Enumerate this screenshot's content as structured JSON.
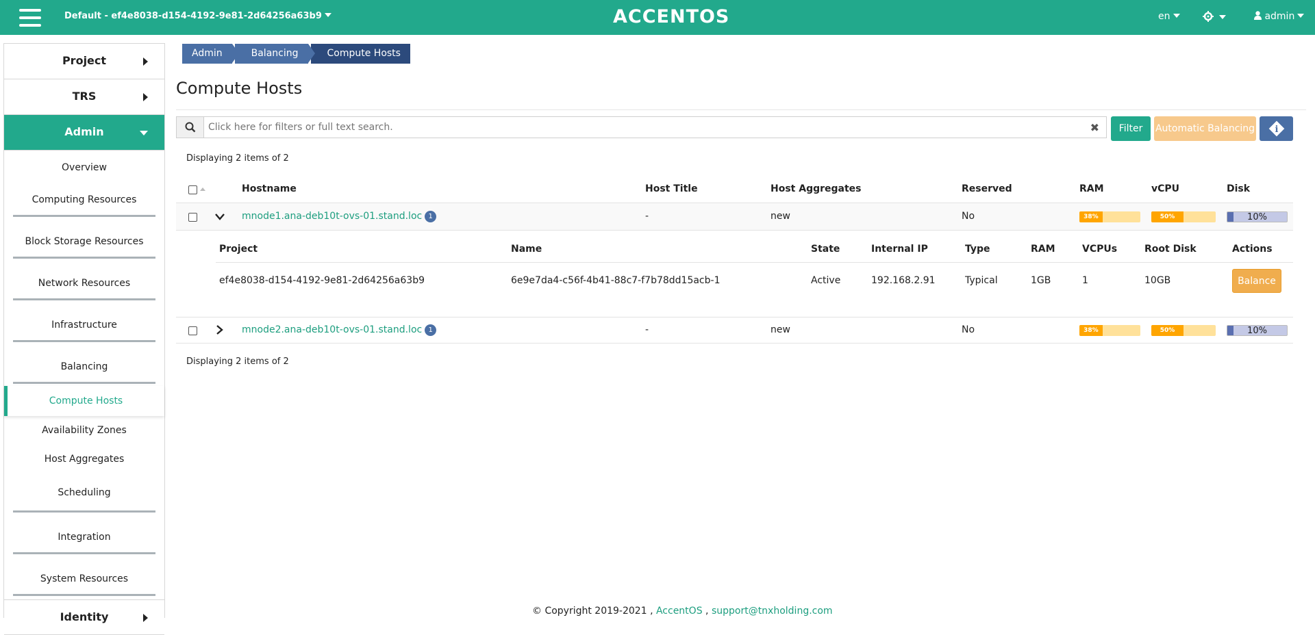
{
  "topbar": {
    "project": "Default - ef4e8038-d154-4192-9e81-2d64256a63b9",
    "logo": "ACCENTOS",
    "lang": "en",
    "user": "admin"
  },
  "sidebar": {
    "mains": {
      "project": "Project",
      "trs": "TRS",
      "admin": "Admin",
      "identity": "Identity"
    },
    "items": [
      "Overview",
      "Computing Resources",
      "Block Storage Resources",
      "Network Resources",
      "Infrastructure",
      "Balancing",
      "Compute Hosts",
      "Availability Zones",
      "Host Aggregates",
      "Scheduling",
      "Integration",
      "System Resources"
    ]
  },
  "breadcrumb": [
    "Admin",
    "Balancing",
    "Compute Hosts"
  ],
  "page_title": "Compute Hosts",
  "search": {
    "placeholder": "Click here for filters or full text search."
  },
  "buttons": {
    "filter": "Filter",
    "auto_balancing": "Automatic Balancing",
    "info": "i"
  },
  "count_text": "Displaying 2 items of 2",
  "table": {
    "headers": [
      "Hostname",
      "Host Title",
      "Host Aggregates",
      "Reserved",
      "RAM",
      "vCPU",
      "Disk"
    ],
    "rows": [
      {
        "hostname": "mnode1.ana-deb10t-ovs-01.stand.loc",
        "badge": "1",
        "title": "-",
        "aggregates": "new",
        "reserved": "No",
        "ram": "38%",
        "vcpu": "50%",
        "disk": "10%"
      },
      {
        "hostname": "mnode2.ana-deb10t-ovs-01.stand.loc",
        "badge": "1",
        "title": "-",
        "aggregates": "new",
        "reserved": "No",
        "ram": "38%",
        "vcpu": "50%",
        "disk": "10%"
      }
    ]
  },
  "subtable": {
    "headers": [
      "Project",
      "Name",
      "State",
      "Internal IP",
      "Type",
      "RAM",
      "VCPUs",
      "Root Disk",
      "Actions"
    ],
    "row": {
      "project": "ef4e8038-d154-4192-9e81-2d64256a63b9",
      "name": "6e9e7da4-c56f-4b41-88c7-f7b78dd15acb-1",
      "state": "Active",
      "ip": "192.168.2.91",
      "type": "Typical",
      "ram": "1GB",
      "vcpus": "1",
      "disk": "10GB",
      "action": "Balance"
    }
  },
  "footer": {
    "copyright": "© Copyright 2019-2021 , ",
    "brand": "AccentOS",
    "sep": " , ",
    "email": "support@tnxholding.com"
  },
  "colors": {
    "primary": "#22a98c",
    "breadcrumb": "#4a6fa5",
    "warning": "#f0ad4e",
    "bar_orange": "#ffa500",
    "bar_disk": "#5a6fb0"
  }
}
